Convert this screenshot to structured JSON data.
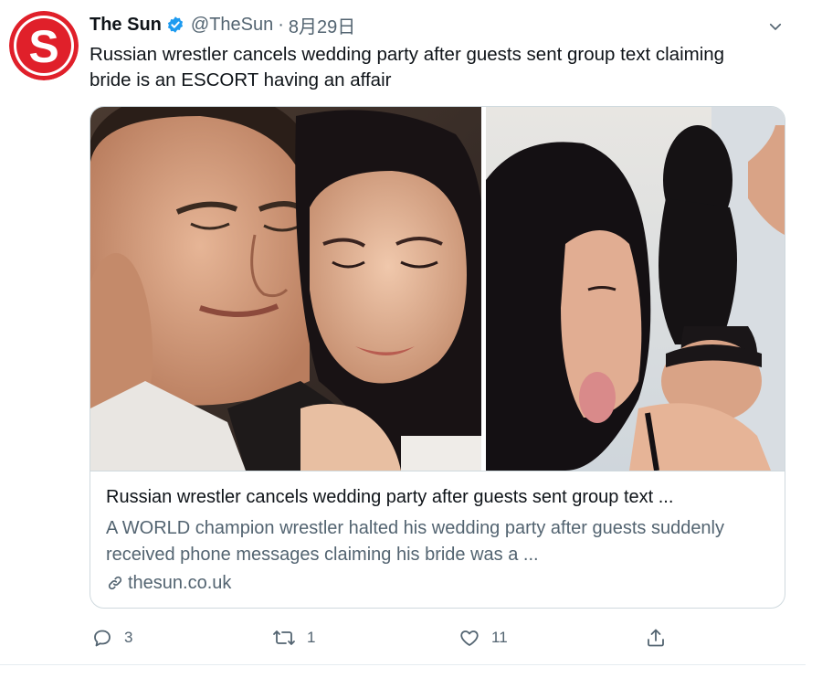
{
  "tweet": {
    "author_name": "The Sun",
    "handle": "@TheSun",
    "separator": "·",
    "time": "8月29日",
    "text": "Russian wrestler cancels wedding party after guests sent group text claiming bride is an ESCORT having an affair"
  },
  "avatar": {
    "letter": "S",
    "color": "#e0202a"
  },
  "icons": {
    "verified": "verified-badge-icon",
    "more": "chevron-down-icon",
    "reply": "reply-icon",
    "retweet": "retweet-icon",
    "like": "heart-icon",
    "share": "share-icon",
    "link": "link-icon"
  },
  "card": {
    "title": "Russian wrestler cancels wedding party after guests sent group text ...",
    "description": "A WORLD champion wrestler halted his wedding party after guests suddenly received phone messages claiming his bride was a ...",
    "domain": "thesun.co.uk"
  },
  "actions": {
    "replies": "3",
    "retweets": "1",
    "likes": "11"
  },
  "colors": {
    "accent": "#1d9bf0",
    "secondary_text": "#536471",
    "border": "#cfd9de"
  }
}
